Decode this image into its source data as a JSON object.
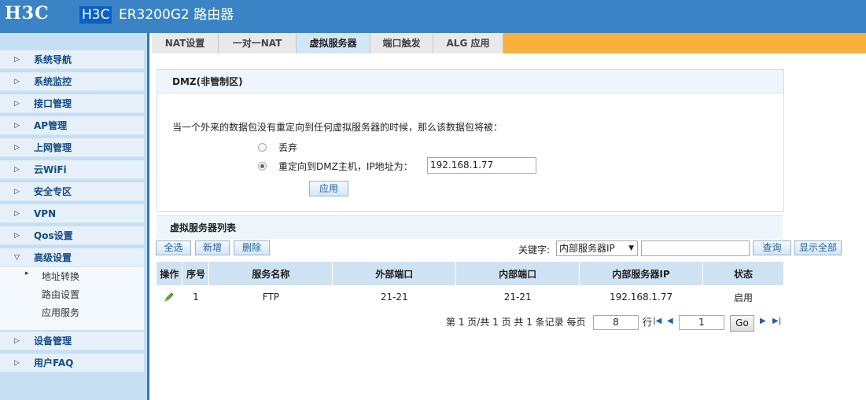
{
  "header": {
    "logo": "H3C",
    "model_highlight": "H3C",
    "model_rest": "ER3200G2 路由器"
  },
  "sidebar": {
    "items": [
      {
        "label": "系统导航"
      },
      {
        "label": "系统监控"
      },
      {
        "label": "接口管理"
      },
      {
        "label": "AP管理"
      },
      {
        "label": "上网管理"
      },
      {
        "label": "云WiFi"
      },
      {
        "label": "安全专区"
      },
      {
        "label": "VPN"
      },
      {
        "label": "Qos设置"
      },
      {
        "label": "高级设置"
      }
    ],
    "sub_items": [
      {
        "label": "地址转换"
      },
      {
        "label": "路由设置"
      },
      {
        "label": "应用服务"
      }
    ],
    "bottom_items": [
      {
        "label": "设备管理"
      },
      {
        "label": "用户FAQ"
      }
    ]
  },
  "tabs": [
    {
      "label": "NAT设置"
    },
    {
      "label": "一对一NAT"
    },
    {
      "label": "虚拟服务器"
    },
    {
      "label": "端口触发"
    },
    {
      "label": "ALG 应用"
    }
  ],
  "dmz": {
    "title": "DMZ(非管制区)",
    "description": "当一个外来的数据包没有重定向到任何虚拟服务器的时候，那么该数据包将被：",
    "option_discard": "丢弃",
    "option_redirect": "重定向到DMZ主机，IP地址为：",
    "ip_value": "192.168.1.77",
    "apply": "应用"
  },
  "list": {
    "title": "虚拟服务器列表",
    "btn_select_all": "全选",
    "btn_add": "新增",
    "btn_delete": "删除",
    "keyword_label": "关键字:",
    "keyword_select": "内部服务器IP",
    "btn_query": "查询",
    "btn_show_all": "显示全部",
    "columns": [
      "操作",
      "序号",
      "服务名称",
      "外部端口",
      "内部端口",
      "内部服务器IP",
      "状态"
    ],
    "rows": [
      {
        "index": "1",
        "name": "FTP",
        "ext_port": "21-21",
        "int_port": "21-21",
        "ip": "192.168.1.77",
        "status": "启用"
      }
    ]
  },
  "pager": {
    "summary": "第 1 页/共 1 页 共 1 条记录 每页",
    "per_page": "8",
    "row_label": "行",
    "page": "1",
    "go": "Go"
  },
  "colors": {
    "header_blue": "#3a84c5",
    "tab_orange": "#f8b03d",
    "table_head": "#cfe2f3"
  }
}
